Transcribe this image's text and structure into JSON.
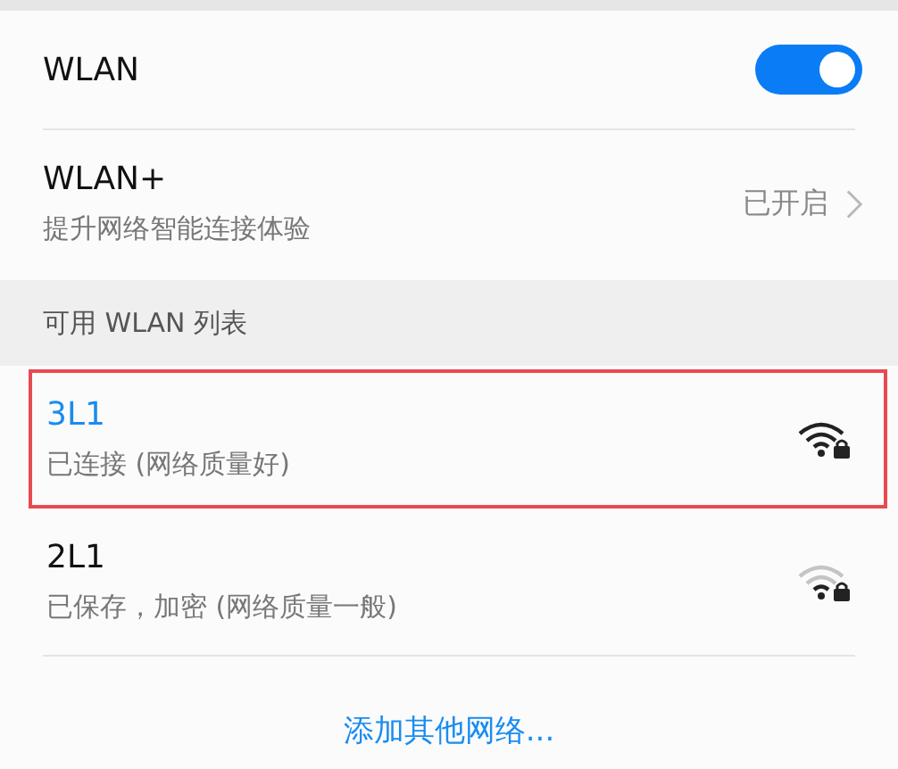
{
  "wlan": {
    "label": "WLAN",
    "on": true
  },
  "wlan_plus": {
    "title": "WLAN+",
    "subtitle": "提升网络智能连接体验",
    "status": "已开启"
  },
  "section_header": "可用 WLAN 列表",
  "networks": [
    {
      "name": "3L1",
      "status": "已连接 (网络质量好)",
      "connected": true,
      "selected": true
    },
    {
      "name": "2L1",
      "status": "已保存，加密 (网络质量一般)",
      "connected": false,
      "selected": false
    }
  ],
  "add_network": "添加其他网络..."
}
